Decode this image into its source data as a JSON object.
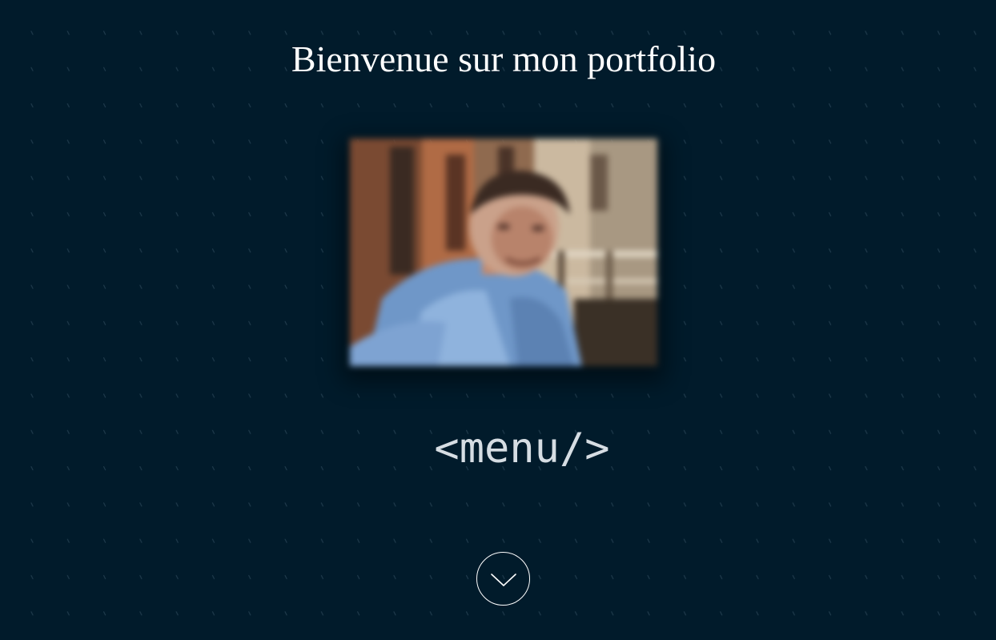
{
  "header": {
    "title": "Bienvenue sur mon portfolio"
  },
  "hero": {
    "photo": {
      "icon": "profile-photo",
      "blurred": true
    },
    "menu_label": "<menu/>",
    "scroll_icon": "chevron-down-icon"
  },
  "colors": {
    "background": "#011b2b",
    "pattern": "#1f3a4b",
    "title": "#ffffff",
    "menu_text": "#d6dde3",
    "scroll_border": "#ffffff"
  }
}
